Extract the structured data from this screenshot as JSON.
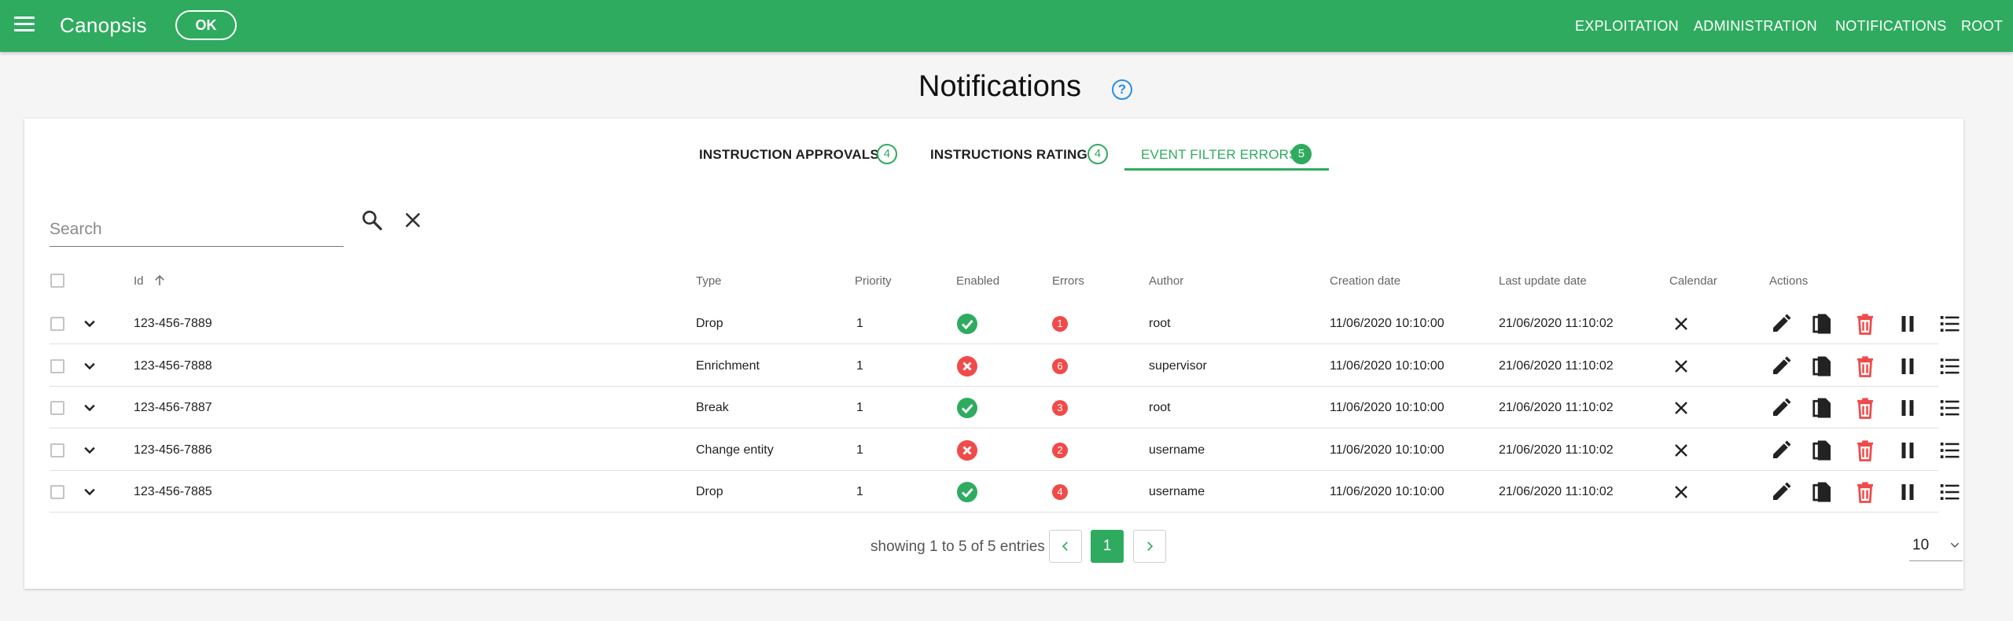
{
  "topbar": {
    "title": "Canopsis",
    "ok_label": "OK",
    "nav": [
      "EXPLOITATION",
      "ADMINISTRATION",
      "NOTIFICATIONS",
      "ROOT"
    ],
    "color": "#2fab5f"
  },
  "page": {
    "title": "Notifications",
    "help_glyph": "?"
  },
  "tabs": [
    {
      "label": "INSTRUCTION APPROVALS",
      "count": "4",
      "active": false
    },
    {
      "label": "INSTRUCTIONS RATING",
      "count": "4",
      "active": false
    },
    {
      "label": "EVENT FILTER ERRORS",
      "count": "5",
      "active": true
    }
  ],
  "search": {
    "placeholder": "Search",
    "value": ""
  },
  "table": {
    "headers": {
      "id": "Id",
      "type": "Type",
      "priority": "Priority",
      "enabled": "Enabled",
      "errors": "Errors",
      "author": "Author",
      "creation_date": "Creation date",
      "last_update_date": "Last update date",
      "calendar": "Calendar",
      "actions": "Actions"
    },
    "sort": {
      "column": "id",
      "direction": "ascending"
    },
    "rows": [
      {
        "id": "123-456-7889",
        "type": "Drop",
        "priority": "1",
        "enabled": true,
        "errors": "1",
        "author": "root",
        "creation_date": "11/06/2020 10:10:00",
        "last_update_date": "21/06/2020 11:10:02"
      },
      {
        "id": "123-456-7888",
        "type": "Enrichment",
        "priority": "1",
        "enabled": false,
        "errors": "6",
        "author": "supervisor",
        "creation_date": "11/06/2020 10:10:00",
        "last_update_date": "21/06/2020 11:10:02"
      },
      {
        "id": "123-456-7887",
        "type": "Break",
        "priority": "1",
        "enabled": true,
        "errors": "3",
        "author": "root",
        "creation_date": "11/06/2020 10:10:00",
        "last_update_date": "21/06/2020 11:10:02"
      },
      {
        "id": "123-456-7886",
        "type": "Change entity",
        "priority": "1",
        "enabled": false,
        "errors": "2",
        "author": "username",
        "creation_date": "11/06/2020 10:10:00",
        "last_update_date": "21/06/2020 11:10:02"
      },
      {
        "id": "123-456-7885",
        "type": "Drop",
        "priority": "1",
        "enabled": true,
        "errors": "4",
        "author": "username",
        "creation_date": "11/06/2020 10:10:00",
        "last_update_date": "21/06/2020 11:10:02"
      }
    ],
    "actions": [
      "edit-icon",
      "duplicate-icon",
      "delete-icon",
      "pause-icon",
      "list-icon"
    ]
  },
  "pagination": {
    "text": "showing 1 to 5 of 5 entries",
    "current_page": "1",
    "per_page": "10"
  },
  "colors": {
    "accent": "#2fab5f",
    "error": "#f04a4a",
    "delete": "#f04a4a",
    "help": "#2a8ee6"
  }
}
